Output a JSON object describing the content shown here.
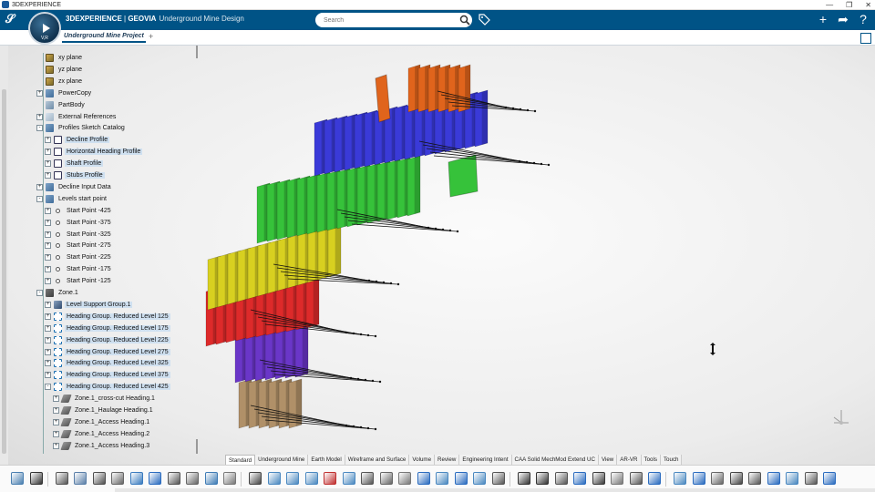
{
  "window": {
    "title": "3DEXPERIENCE",
    "controls": [
      "—",
      "❐",
      "✕"
    ]
  },
  "topbar": {
    "brand_prefix": "3DEXPERIENCE",
    "brand_sep": " | ",
    "brand_name": "GEOVIA",
    "app_name": "Underground Mine Design",
    "search_placeholder": "Search",
    "bg_color": "#005386"
  },
  "compass": {
    "version": "V,R"
  },
  "tabs": {
    "active": "Underground Mine Project",
    "add": "+"
  },
  "tree": [
    {
      "label": "xy plane",
      "icon": "plane-icon",
      "level": 1,
      "expander": "",
      "y": 0
    },
    {
      "label": "yz plane",
      "icon": "plane-icon",
      "level": 1,
      "expander": "",
      "y": 1
    },
    {
      "label": "zx plane",
      "icon": "plane-icon",
      "level": 1,
      "expander": "",
      "y": 2
    },
    {
      "label": "PowerCopy",
      "icon": "tools-icon",
      "level": 1,
      "expander": "+",
      "y": 3
    },
    {
      "label": "PartBody",
      "icon": "body-icon",
      "level": 1,
      "expander": "",
      "y": 4
    },
    {
      "label": "External References",
      "icon": "extref-icon",
      "level": 1,
      "expander": "+",
      "y": 5
    },
    {
      "label": "Profiles Sketch Catalog",
      "icon": "tools-icon",
      "level": 1,
      "expander": "-",
      "y": 6
    },
    {
      "label": "Decline Profile",
      "icon": "sketch-icon",
      "level": 2,
      "expander": "+",
      "y": 7,
      "selected": true
    },
    {
      "label": "Horizontal Heading Profile",
      "icon": "sketch-icon",
      "level": 2,
      "expander": "+",
      "y": 8,
      "selected": true
    },
    {
      "label": "Shaft Profile",
      "icon": "sketch-icon",
      "level": 2,
      "expander": "+",
      "y": 9,
      "selected": true
    },
    {
      "label": "Stubs Profile",
      "icon": "sketch-icon",
      "level": 2,
      "expander": "+",
      "y": 10,
      "selected": true
    },
    {
      "label": "Decline Input Data",
      "icon": "tools-icon",
      "level": 1,
      "expander": "+",
      "y": 11
    },
    {
      "label": "Levels start point",
      "icon": "tools-icon",
      "level": 1,
      "expander": "-",
      "y": 12
    },
    {
      "label": "Start Point -425",
      "icon": "point-icon",
      "level": 2,
      "expander": "+",
      "y": 13
    },
    {
      "label": "Start Point -375",
      "icon": "point-icon",
      "level": 2,
      "expander": "+",
      "y": 14
    },
    {
      "label": "Start Point -325",
      "icon": "point-icon",
      "level": 2,
      "expander": "+",
      "y": 15
    },
    {
      "label": "Start Point -275",
      "icon": "point-icon",
      "level": 2,
      "expander": "+",
      "y": 16
    },
    {
      "label": "Start Point -225",
      "icon": "point-icon",
      "level": 2,
      "expander": "+",
      "y": 17
    },
    {
      "label": "Start Point -175",
      "icon": "point-icon",
      "level": 2,
      "expander": "+",
      "y": 18
    },
    {
      "label": "Start Point -125",
      "icon": "point-icon",
      "level": 2,
      "expander": "+",
      "y": 19
    },
    {
      "label": "Zone.1",
      "icon": "zone-icon",
      "level": 1,
      "expander": "-",
      "y": 20
    },
    {
      "label": "Level Support Group.1",
      "icon": "lsg-icon",
      "level": 2,
      "expander": "+",
      "y": 21,
      "selected": true
    },
    {
      "label": "Heading Group. Reduced Level 125",
      "icon": "heading-icon",
      "level": 2,
      "expander": "+",
      "y": 22,
      "selected": true
    },
    {
      "label": "Heading Group. Reduced Level 175",
      "icon": "heading-icon",
      "level": 2,
      "expander": "+",
      "y": 23,
      "selected": true
    },
    {
      "label": "Heading Group. Reduced Level 225",
      "icon": "heading-icon",
      "level": 2,
      "expander": "+",
      "y": 24,
      "selected": true
    },
    {
      "label": "Heading Group. Reduced Level 275",
      "icon": "heading-icon",
      "level": 2,
      "expander": "+",
      "y": 25,
      "selected": true
    },
    {
      "label": "Heading Group. Reduced Level 325",
      "icon": "heading-icon",
      "level": 2,
      "expander": "+",
      "y": 26,
      "selected": true
    },
    {
      "label": "Heading Group. Reduced Level 375",
      "icon": "heading-icon",
      "level": 2,
      "expander": "+",
      "y": 27,
      "selected": true
    },
    {
      "label": "Heading Group. Reduced Level 425",
      "icon": "heading-icon",
      "level": 2,
      "expander": "-",
      "y": 28,
      "selected": true
    },
    {
      "label": "Zone.1_cross-cut Heading.1",
      "icon": "heading2-icon",
      "level": 3,
      "expander": "+",
      "y": 29
    },
    {
      "label": "Zone.1_Haulage Heading.1",
      "icon": "heading2-icon",
      "level": 3,
      "expander": "+",
      "y": 30
    },
    {
      "label": "Zone.1_Access Heading.1",
      "icon": "heading2-icon",
      "level": 3,
      "expander": "+",
      "y": 31
    },
    {
      "label": "Zone.1_Access Heading.2",
      "icon": "heading2-icon",
      "level": 3,
      "expander": "+",
      "y": 32
    },
    {
      "label": "Zone.1_Access Heading.3",
      "icon": "heading2-icon",
      "level": 3,
      "expander": "+",
      "y": 33
    }
  ],
  "section_tabs": [
    "Standard",
    "Underground Mine",
    "Earth Model",
    "Wireframe and Surface",
    "Volume",
    "Review",
    "Engineering Intent",
    "CAA Solid MechMod Extend UC",
    "View",
    "AR-VR",
    "Tools",
    "Touch"
  ],
  "active_section_tab": "Standard",
  "colors": {
    "level_orange": "#e0641c",
    "level_blue": "#3a3ad8",
    "level_green": "#36c23a",
    "level_yellow": "#d8d020",
    "level_red": "#dd2a2a",
    "level_purple": "#6a36c8",
    "level_tan": "#b09068",
    "selection": "#cfe0f0"
  }
}
